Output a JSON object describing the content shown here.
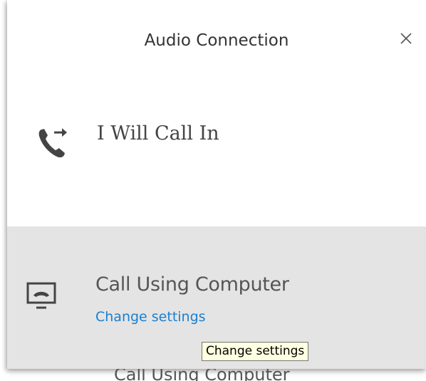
{
  "dialog": {
    "title": "Audio Connection",
    "close_icon": "close-icon"
  },
  "options": {
    "call_in": {
      "label": "I Will Call In",
      "icon": "phone-forward-icon"
    },
    "computer": {
      "label": "Call Using Computer",
      "icon": "computer-phone-icon",
      "link_label": "Change settings"
    }
  },
  "tooltip": {
    "text": "Change settings"
  },
  "background_label": "Call Using Computer",
  "colors": {
    "selected_background": "#e4e4e4",
    "link": "#1a7fd0",
    "tooltip_background": "#ffffe1"
  }
}
